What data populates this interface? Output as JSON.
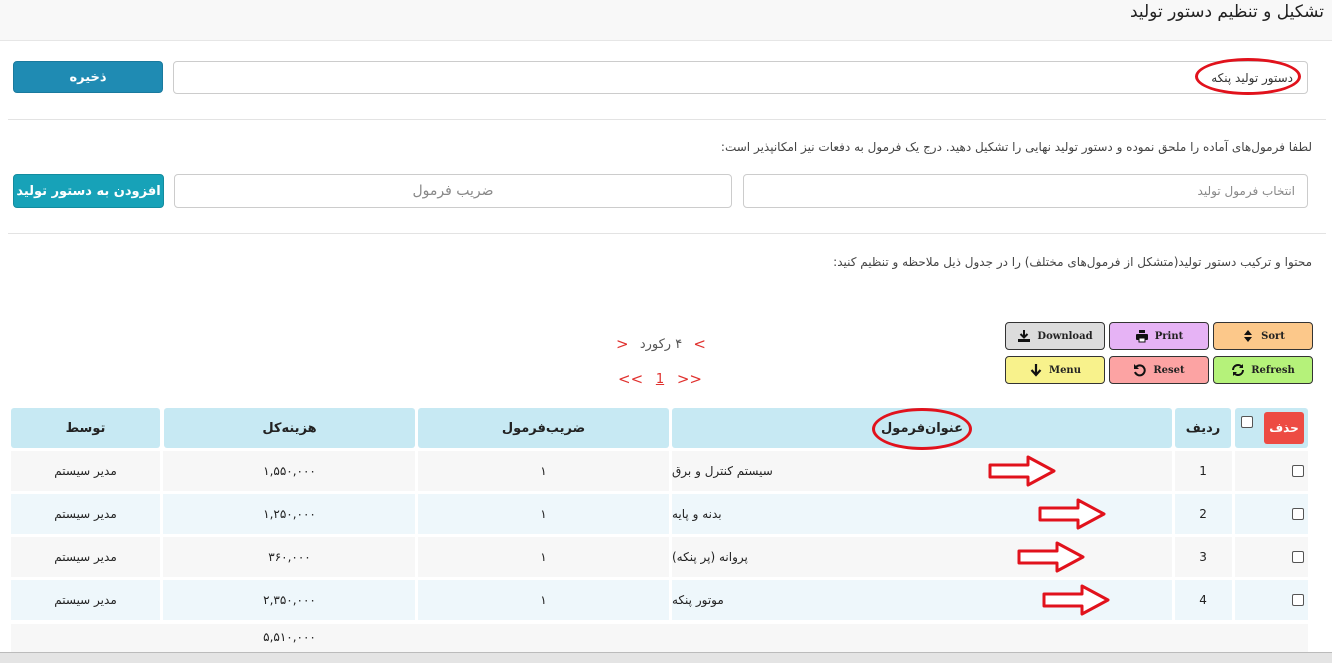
{
  "page": {
    "title": "تشکیل و تنظیم دستور تولید"
  },
  "order": {
    "name_value": "دستور تولید پنکه",
    "save_label": "ذخیره"
  },
  "formula": {
    "help": "لطفا فرمول‌های آماده را ملحق نموده و دستور تولید نهایی را تشکیل دهید. درج یک فرمول به دفعات نیز امکانپذیر است:",
    "select_placeholder": "انتخاب فرمول تولید",
    "coef_placeholder": "ضریب فرمول",
    "add_label": "افزودن به دستور تولید"
  },
  "content_help": "محتوا و ترکیب دستور تولید(متشکل از فرمول‌های مختلف) را در جدول ذیل ملاحظه و تنظیم کنید:",
  "toolbar": {
    "download": "Download",
    "print": "Print",
    "sort": "Sort",
    "menu": "Menu",
    "reset": "Reset",
    "refresh": "Refresh",
    "colors": {
      "download": "#dcdcdc",
      "print": "#e6b3f5",
      "sort": "#fcc88a",
      "menu": "#f8f28c",
      "reset": "#fca3a3",
      "refresh": "#b5f27a"
    }
  },
  "pager": {
    "prev": "<",
    "next": ">",
    "records": "۴ رکورد",
    "first": "<<",
    "last": ">>",
    "page": "1"
  },
  "table": {
    "delete_label": "حذف",
    "headers": {
      "row": "ردیف",
      "title": "عنوان‌فرمول",
      "coef": "ضریب‌فرمول",
      "cost": "هزینه‌کل",
      "by": "توسط"
    },
    "rows": [
      {
        "row": "1",
        "title": "سیستم کنترل و برق",
        "coef": "۱",
        "cost": "۱,۵۵۰,۰۰۰",
        "by": "مدیر سیستم"
      },
      {
        "row": "2",
        "title": "بدنه و پایه",
        "coef": "۱",
        "cost": "۱,۲۵۰,۰۰۰",
        "by": "مدیر سیستم"
      },
      {
        "row": "3",
        "title": "پروانه (پر پنکه)",
        "coef": "۱",
        "cost": "۳۶۰,۰۰۰",
        "by": "مدیر سیستم"
      },
      {
        "row": "4",
        "title": "موتور پنکه",
        "coef": "۱",
        "cost": "۲,۳۵۰,۰۰۰",
        "by": "مدیر سیستم"
      }
    ],
    "total_cost": "۵,۵۱۰,۰۰۰"
  },
  "annotation_color": "#e1121c"
}
